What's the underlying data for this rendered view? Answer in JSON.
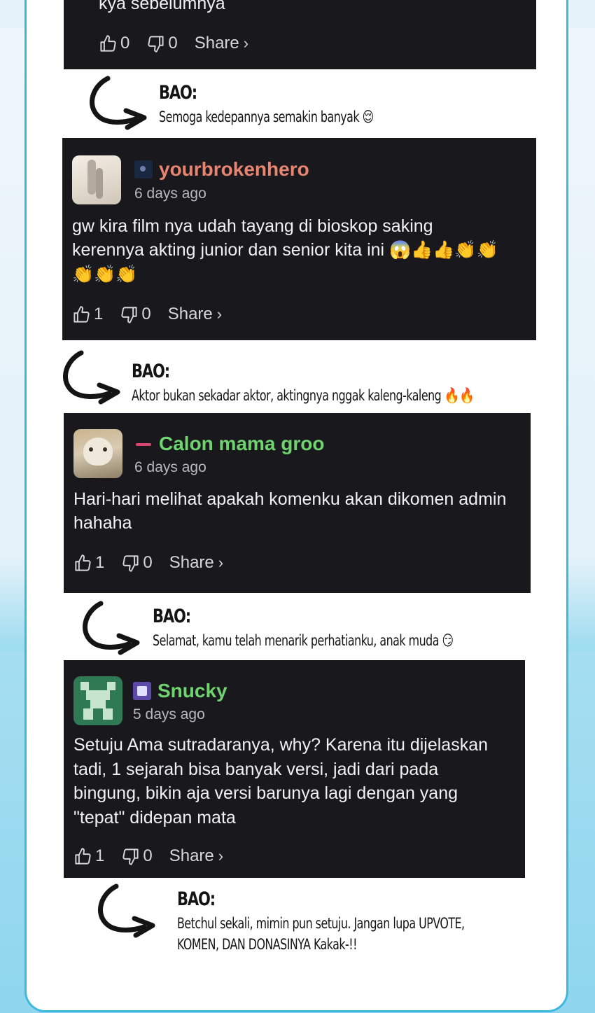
{
  "comments": [
    {
      "id": "c0",
      "text": "kya sebelumnya",
      "likes": "0",
      "dislikes": "0",
      "share": "Share"
    },
    {
      "id": "c1",
      "username": "yourbrokenhero",
      "time": "6 days ago",
      "text_line1": "gw kira film nya udah tayang di bioskop saking",
      "text_line2": "kerennya akting junior dan senior kita ini 😱👍👍👏👏",
      "text_line3": "👏👏👏",
      "likes": "1",
      "dislikes": "0",
      "share": "Share",
      "name_color": "#e8846f"
    },
    {
      "id": "c2",
      "username": "Calon mama groo",
      "time": "6 days ago",
      "text_line1": "Hari-hari melihat apakah komenku akan dikomen admin",
      "text_line2": "hahaha",
      "likes": "1",
      "dislikes": "0",
      "share": "Share",
      "name_color": "#6fd46f"
    },
    {
      "id": "c3",
      "username": "Snucky",
      "time": "5 days ago",
      "text_line1": "Setuju Ama sutradaranya, why? Karena itu dijelaskan",
      "text_line2": "tadi, 1 sejarah bisa banyak versi, jadi dari pada",
      "text_line3": "bingung, bikin aja versi barunya lagi dengan yang",
      "text_line4": "\"tepat\" didepan mata",
      "likes": "1",
      "dislikes": "0",
      "share": "Share",
      "name_color": "#6fd46f"
    }
  ],
  "bao_replies": [
    {
      "label": "BAO:",
      "line1": "Semoga kedepannya semakin banyak 😌"
    },
    {
      "label": "BAO:",
      "line1": "Aktor bukan sekadar aktor, aktingnya nggak kaleng-kaleng 🔥🔥"
    },
    {
      "label": "BAO:",
      "line1": "Selamat, kamu telah menarik perhatianku, anak muda 😏"
    },
    {
      "label": "BAO:",
      "line1": "Betchul sekali, mimin pun setuju. Jangan lupa UPVOTE,",
      "line2": "KOMEN, DAN DONASINYA Kakak-!!"
    }
  ],
  "icons": {
    "like": "thumbs-up-icon",
    "dislike": "thumbs-down-icon",
    "share_chevron": "chevron-right-icon",
    "arrow": "curved-arrow-icon"
  },
  "colors": {
    "comment_bg": "#19191d",
    "frame_border": "#3fb8de"
  }
}
